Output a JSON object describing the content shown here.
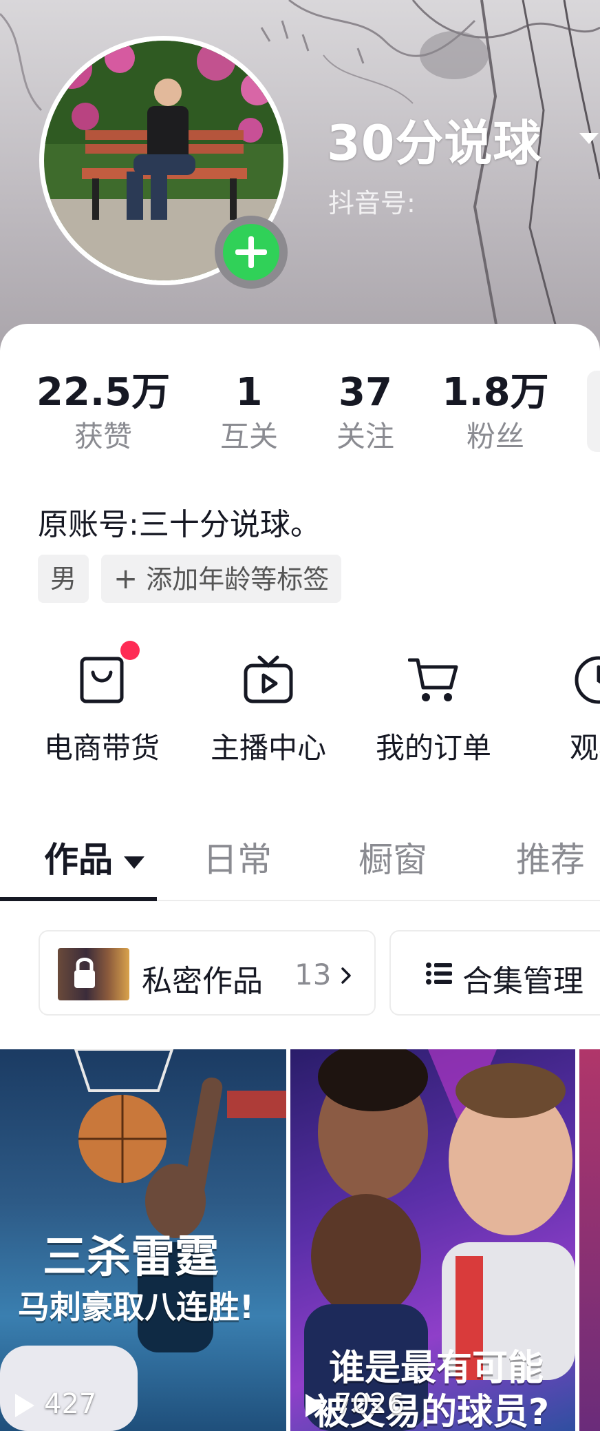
{
  "profile": {
    "username": "30分说球",
    "douyin_id_label": "抖音号: "
  },
  "stats": [
    {
      "value": "22.5万",
      "label": "获赞"
    },
    {
      "value": "1",
      "label": "互关"
    },
    {
      "value": "37",
      "label": "关注"
    },
    {
      "value": "1.8万",
      "label": "粉丝"
    }
  ],
  "bio": "原账号:三十分说球。",
  "tags": {
    "gender": "男",
    "add_tag": "添加年龄等标签"
  },
  "services": [
    {
      "label": "电商带货",
      "icon": "shopping-bag-icon"
    },
    {
      "label": "主播中心",
      "icon": "tv-play-icon"
    },
    {
      "label": "我的订单",
      "icon": "cart-icon"
    },
    {
      "label": "观看",
      "icon": "clock-icon"
    }
  ],
  "tabs": [
    {
      "label": "作品"
    },
    {
      "label": "日常"
    },
    {
      "label": "橱窗"
    },
    {
      "label": "推荐"
    }
  ],
  "private_works": {
    "label": "私密作品",
    "count": "13"
  },
  "collection": {
    "label": "合集管理"
  },
  "videos": [
    {
      "title_line1": "三杀雷霆",
      "title_line2": "马刺豪取八连胜!",
      "plays": "427"
    },
    {
      "title_line1": "谁是最有可能",
      "title_line2": "被交易的球员?",
      "plays": "7026"
    }
  ],
  "colors": {
    "accent_red": "#fe2c55",
    "add_green": "#30d158",
    "text_primary": "#161823",
    "text_secondary": "#8a8b91"
  }
}
